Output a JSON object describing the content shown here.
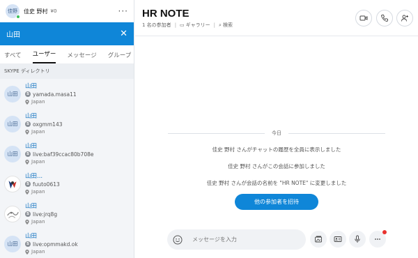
{
  "profile": {
    "initials": "佳野",
    "name": "佳史 野村",
    "credit": "¥0",
    "more": "···"
  },
  "search": {
    "query": "山田",
    "close": "✕"
  },
  "tabs": [
    {
      "label": "すべて",
      "active": false
    },
    {
      "label": "ユーザー",
      "active": true
    },
    {
      "label": "メッセージ",
      "active": false
    },
    {
      "label": "グループ",
      "active": false
    }
  ],
  "directory": {
    "prefix": "SKYPE",
    "label": "ディレクトリ"
  },
  "results": [
    {
      "avatar": "山田",
      "name": "山田",
      "id": "yamada.masa11",
      "location": "Japan"
    },
    {
      "avatar": "山田",
      "name": "山田",
      "id": "oxgmm143",
      "location": "Japan"
    },
    {
      "avatar": "山田",
      "name": "山田",
      "id": "live:baf39ccac80b708e",
      "location": "Japan"
    },
    {
      "avatar": "",
      "name": "山田...",
      "id": "fuuto0613",
      "location": "Japan"
    },
    {
      "avatar": "",
      "name": "山田",
      "id": "live:jrq8g",
      "location": "Japan"
    },
    {
      "avatar": "山田",
      "name": "山田",
      "id": "live:opmmakd.ok",
      "location": "Japan"
    }
  ],
  "conversation": {
    "title": "HR NOTE",
    "participants": "1 名の参加者",
    "gallery": "ギャラリー",
    "search": "検索",
    "day": "今日",
    "messages": [
      "佳史 野村 さんがチャットの履歴を全員に表示しました",
      "佳史 野村 さんがこの会話に参加しました",
      "佳史 野村 さんが会話の名前を \"HR NOTE\" に変更しました"
    ],
    "invite": "他の参加者を招待",
    "composer_placeholder": "メッセージを入力"
  },
  "icons": {
    "video": "video-camera-icon",
    "call": "phone-icon",
    "add_person": "add-person-icon",
    "emoji": "smiley-icon",
    "media": "image-gallery-icon",
    "contact": "contact-card-icon",
    "mic": "microphone-icon",
    "more": "more-dots-icon"
  },
  "colors": {
    "accent": "#0f86d8",
    "link": "#0b6fbf",
    "presence": "#3cbf5a",
    "notification": "#e8322e"
  }
}
